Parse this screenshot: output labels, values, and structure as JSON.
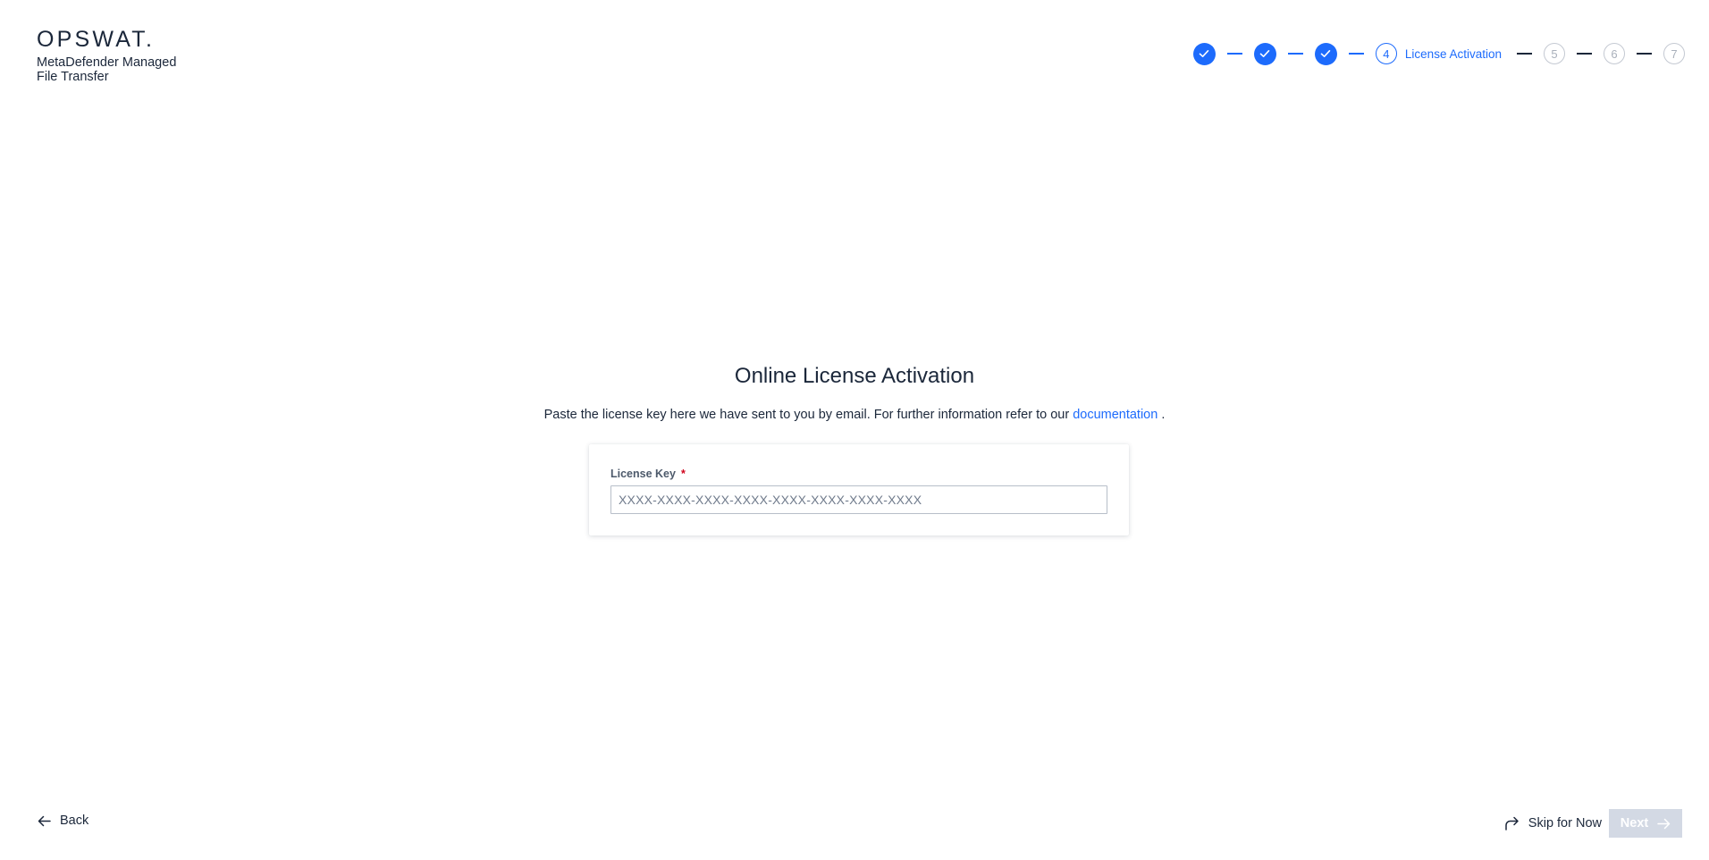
{
  "brand": {
    "logo": "OPSWAT.",
    "product": "MetaDefender Managed File Transfer"
  },
  "stepper": {
    "active_number": "4",
    "active_label": "License Activation",
    "pending": [
      "5",
      "6",
      "7"
    ],
    "accent_color": "#1d6bfc"
  },
  "main": {
    "title": "Online License Activation",
    "description": "Paste the license key here we have sent to you by email. For further information refer to our",
    "doc_link": "documentation",
    "description_end": " ."
  },
  "form": {
    "license_label": "License Key",
    "required_mark": "*",
    "license_placeholder": "XXXX-XXXX-XXXX-XXXX-XXXX-XXXX-XXXX-XXXX",
    "license_value": ""
  },
  "footer": {
    "back_label": "Back",
    "skip_label": "Skip for Now",
    "next_label": "Next"
  }
}
